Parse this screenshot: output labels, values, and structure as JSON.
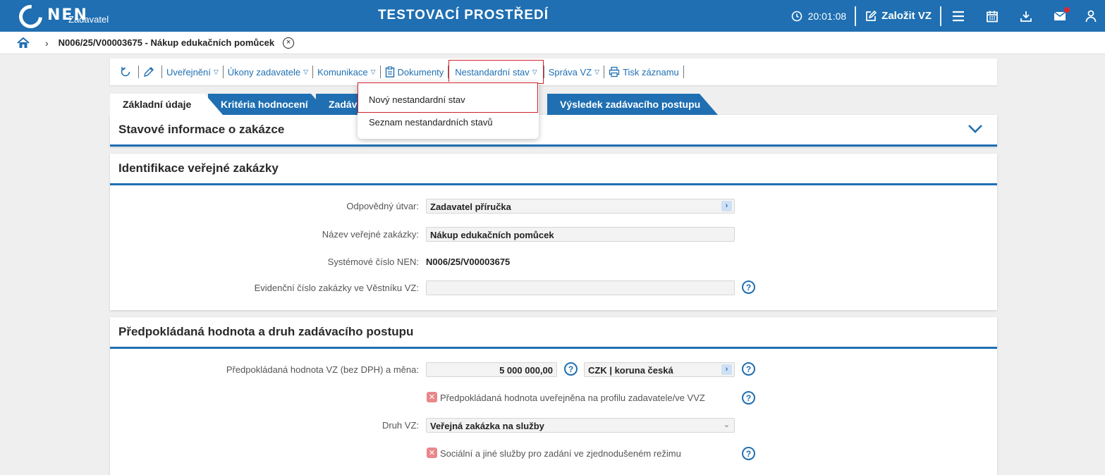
{
  "header": {
    "logo_text": "NEN",
    "logo_sub": "Zadavatel",
    "environment": "TESTOVACÍ PROSTŘEDÍ",
    "time": "20:01:08",
    "create_label": "Založit VZ"
  },
  "breadcrumb": {
    "title": "N006/25/V00003675 - Nákup edukačních pomůcek",
    "close": "×"
  },
  "toolbar": {
    "publish": "Uveřejnění",
    "acts": "Úkony zadavatele",
    "communication": "Komunikace",
    "documents": "Dokumenty",
    "nonstandard": "Nestandardní stav",
    "management": "Správa VZ",
    "print": "Tisk záznamu",
    "caret": "▽"
  },
  "dropdown": {
    "items": [
      "Nový nestandardní stav",
      "Seznam nestandardních stavů"
    ]
  },
  "tabs": [
    "Základní údaje",
    "Kritéria hodnocení",
    "Zadáv",
    "Výsledek zadávacího postupu"
  ],
  "sections": {
    "status": {
      "title": "Stavové informace o zakázce"
    },
    "identification": {
      "title": "Identifikace veřejné zakázky",
      "unit_label": "Odpovědný útvar:",
      "unit_value": "Zadavatel příručka",
      "name_label": "Název veřejné zakázky:",
      "name_value": "Nákup edukačních pomůcek",
      "sysno_label": "Systémové číslo NEN:",
      "sysno_value": "N006/25/V00003675",
      "journal_label": "Evidenční číslo zakázky ve Věstníku VZ:",
      "journal_value": ""
    },
    "value": {
      "title": "Předpokládaná hodnota a druh zadávacího postupu",
      "amount_label": "Předpokládaná hodnota VZ (bez DPH) a měna:",
      "amount_value": "5 000 000,00",
      "currency_value": "CZK | koruna česká",
      "published_label": "Předpokládaná hodnota uveřejněna na profilu zadavatele/ve VVZ",
      "kind_label": "Druh VZ:",
      "kind_value": "Veřejná zakázka na služby",
      "social_label": "Sociální a jiné služby pro zadání ve zjednodušeném režimu"
    }
  },
  "glyphs": {
    "help": "?",
    "x": "✕",
    "arrow": "›",
    "select_caret": "⌄"
  },
  "colors": {
    "primary": "#1f6fb2",
    "highlight": "#d0202c",
    "notification": "#e0272f"
  }
}
